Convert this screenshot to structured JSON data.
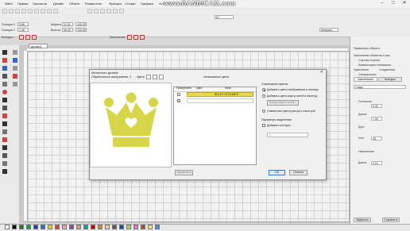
{
  "menu": [
    "Файл",
    "Правка",
    "Просмотр",
    "Дизайн",
    "Объект",
    "Разместить",
    "Функции",
    "Стежки",
    "Графика",
    "Установки",
    "Окно",
    "Справка"
  ],
  "watermark": "www.BANDICAM.com",
  "window_controls": [
    "–",
    "□",
    "✕"
  ],
  "toolbar": {
    "pos_x_label": "Позиция X",
    "pos_x_value": "3.66",
    "pos_y_label": "Позиция Y",
    "pos_y_value": "1.06",
    "width_label": "Ширина",
    "width_value": "11.62",
    "height_label": "Высота",
    "height_value": "45.49",
    "percent1": "100.00",
    "percent2": "100.00",
    "contours_label": "Контуры:",
    "fill_label": "Заполнение:",
    "zoom_value": "67",
    "units": "Метрика"
  },
  "design_tab": "Дизайн1",
  "dialog": {
    "title": "Интеллект-дизайн",
    "close": "✕",
    "processing_label": "Обработанное изображение:",
    "processing_value": "3",
    "colors_label": "Цвета",
    "thread_colors_header": "Несвязанные цвета",
    "col_assign": "Прикрепить",
    "col_color": "Цвет",
    "col_thread": "Нить",
    "row1_thread": "SULKY 1213 #AFE",
    "match_header": "Совмещение цветов",
    "opt_add_image_colors": "Добавить цвета изображения в палитру",
    "opt_add_card_colors": "Добавить цвета карты нитей в палитру",
    "select_thread_map": "Выбор карты нитей...",
    "opt_match_colors": "Совместить цвета растра с палитрой",
    "outline_params": "Параметры выделения",
    "add_contour": "Добавить контуры",
    "contour_value": "1",
    "apply_btn": "Применить",
    "ok_btn": "ОК",
    "cancel_btn": "Отмена"
  },
  "right_panel": {
    "title": "Параметры объекта",
    "fill_options": "Заполнение объектов строк...",
    "opt1": "Строчка стрелки",
    "opt2": "Компенсация стягивания",
    "opt3": "Укрепление",
    "opt4": "Соединения",
    "opt5": "Специальные",
    "tab_fill": "Заполнение",
    "tab_contours": "Контуры",
    "type_value": "Гладь",
    "density_label": "Плотность",
    "density_value": "0.40",
    "length_label": "Длина",
    "length_value": "7.00",
    "section_label": "Дуга",
    "angle_label": "Угол",
    "angle_value": "45",
    "sewing_label": "Наполнение",
    "width_label": "Длина",
    "width_value": "0.10",
    "effects_btn": "Эффекты",
    "save_btn": "Сохранить"
  },
  "palette_colors": [
    "#ffffff",
    "#000000",
    "#1e7d2a",
    "#00a651",
    "#1d3fbf",
    "#2b6bd1",
    "#e5d51c",
    "#e33b2f",
    "#f2a0b6",
    "#8c3fb0",
    "#c6a27a",
    "#00a3a6",
    "#d40000",
    "#d98a21",
    "#f5c8a0",
    "#5b5b5b",
    "#0055a5",
    "#a8d86e",
    "#ff66cc",
    "#9b5a2b",
    "#ffe07a",
    "#3c8fd6"
  ],
  "crown_color": "#d7d64a",
  "accent_yellow": "#e8d84a"
}
